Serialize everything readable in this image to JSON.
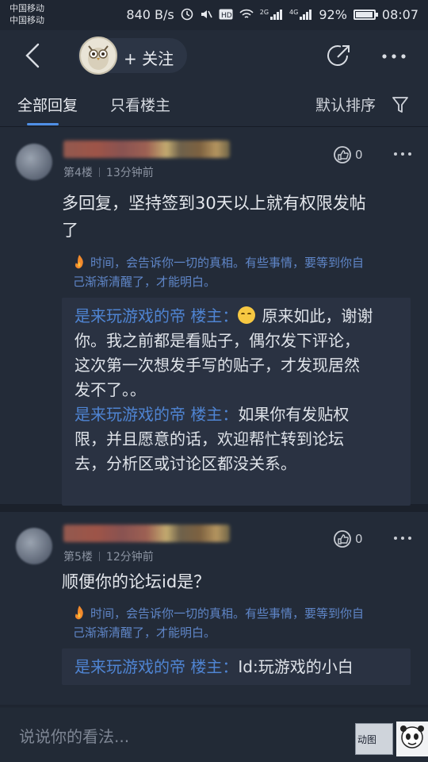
{
  "status_bar": {
    "carrier_1": "中国移动",
    "carrier_2": "中国移动",
    "network_speed": "840 B/s",
    "net_badge_1": "2G",
    "net_badge_2": "4G",
    "battery": "92%",
    "time": "08:07"
  },
  "nav": {
    "follow_label": "+ 关注",
    "icons": [
      "back-icon",
      "owl-avatar",
      "share-icon",
      "more-icon"
    ]
  },
  "tabs": {
    "all_replies": "全部回复",
    "op_only": "只看楼主",
    "sort": "默认排序"
  },
  "replies": [
    {
      "floor": "第4楼",
      "time": "13分钟前",
      "like_count": "0",
      "content_line_1": "多回复，坚持签到30天以上就有权限发帖",
      "content_line_2": "了",
      "signature_line_1": "时间，会告诉你一切的真相。有些事情，要等到你自",
      "signature_line_2": "己渐渐清醒了，才能明白。",
      "sub_replies": [
        {
          "name": "是来玩游戏的帝 楼主：",
          "lines": [
            "原来如此，谢谢",
            "你。我之前都是看贴子，偶尔发下评论，",
            "这次第一次想发手写的贴子，才发现居然",
            "发不了。。"
          ]
        },
        {
          "name": "是来玩游戏的帝 楼主：",
          "lines": [
            "如果你有发贴权",
            "限，并且愿意的话，欢迎帮忙转到论坛",
            "去，分析区或讨论区都没关系。"
          ]
        }
      ]
    },
    {
      "floor": "第5楼",
      "time": "12分钟前",
      "like_count": "0",
      "content_line_1": "顺便你的论坛id是？",
      "signature_line_1": "时间，会告诉你一切的真相。有些事情，要等到你自",
      "signature_line_2": "己渐渐清醒了，才能明白。",
      "sub_replies": [
        {
          "name": "是来玩游戏的帝 楼主：",
          "lines": [
            "Id:玩游戏的小白"
          ]
        }
      ]
    }
  ],
  "bottom": {
    "input_placeholder": "说说你的看法...",
    "gif_label": "动图"
  },
  "colors": {
    "background": "#232b38",
    "accent_blue": "#4f8fe6",
    "sub_name_blue": "#4f84d2",
    "signature_blue": "#5f86c8"
  }
}
